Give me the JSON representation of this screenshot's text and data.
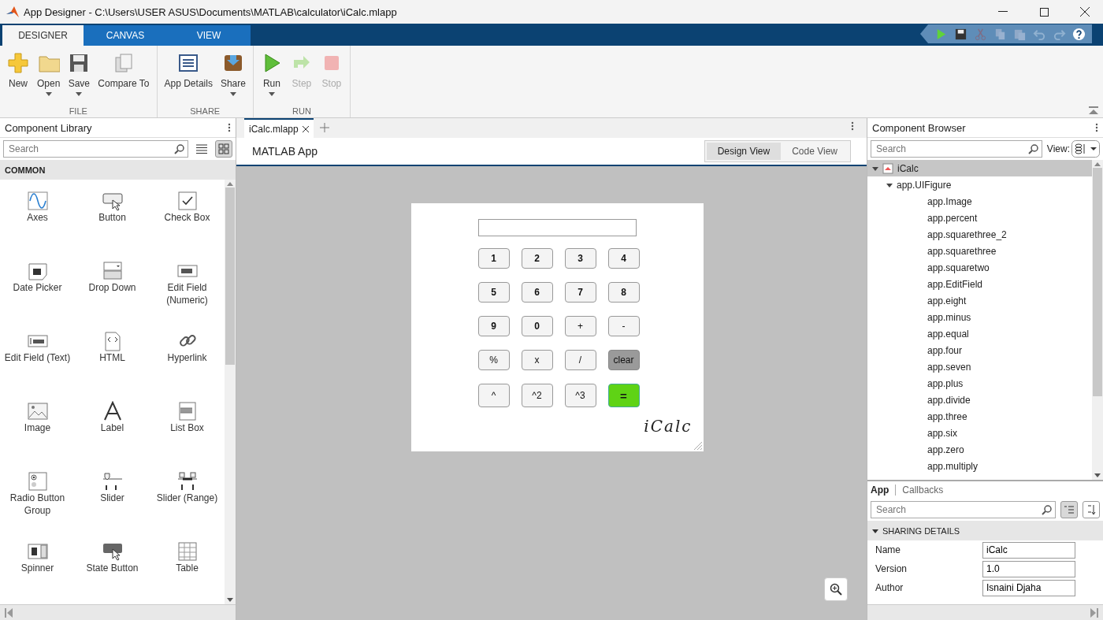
{
  "window": {
    "title": "App Designer - C:\\Users\\USER ASUS\\Documents\\MATLAB\\calculator\\iCalc.mlapp"
  },
  "ribbon_tabs": [
    {
      "label": "DESIGNER",
      "selected": true
    },
    {
      "label": "CANVAS",
      "selected": false
    },
    {
      "label": "VIEW",
      "selected": false
    }
  ],
  "toolbar_groups": [
    {
      "label": "FILE",
      "buttons": [
        {
          "label": "New",
          "dropdown": false,
          "disabled": false
        },
        {
          "label": "Open",
          "dropdown": true,
          "disabled": false
        },
        {
          "label": "Save",
          "dropdown": true,
          "disabled": false
        },
        {
          "label": "Compare To",
          "dropdown": false,
          "disabled": false
        }
      ]
    },
    {
      "label": "SHARE",
      "buttons": [
        {
          "label": "App Details",
          "dropdown": false,
          "disabled": false
        },
        {
          "label": "Share",
          "dropdown": true,
          "disabled": false
        }
      ]
    },
    {
      "label": "RUN",
      "buttons": [
        {
          "label": "Run",
          "dropdown": true,
          "disabled": false
        },
        {
          "label": "Step",
          "dropdown": false,
          "disabled": true
        },
        {
          "label": "Stop",
          "dropdown": false,
          "disabled": true
        }
      ]
    }
  ],
  "quick_access": [
    {
      "disabled": false
    },
    {
      "disabled": false
    },
    {
      "disabled": true
    },
    {
      "disabled": true
    },
    {
      "disabled": true
    },
    {
      "disabled": true
    },
    {
      "disabled": true
    },
    {
      "disabled": false
    }
  ],
  "component_library": {
    "title": "Component Library",
    "search": {
      "placeholder": "Search"
    },
    "views": [
      {
        "selected": false
      },
      {
        "selected": true
      }
    ],
    "section": "COMMON",
    "items": [
      "Axes",
      "Button",
      "Check Box",
      "Date Picker",
      "Drop Down",
      "Edit Field (Numeric)",
      "Edit Field (Text)",
      "HTML",
      "Hyperlink",
      "Image",
      "Label",
      "List Box",
      "Radio Button Group",
      "Slider",
      "Slider (Range)",
      "Spinner",
      "State Button",
      "Table"
    ]
  },
  "editor": {
    "tabs": [
      {
        "label": "iCalc.mlapp",
        "selected": true
      }
    ],
    "app_title": "MATLAB App",
    "views": [
      {
        "label": "Design View",
        "selected": true
      },
      {
        "label": "Code View",
        "selected": false
      }
    ],
    "calculator": {
      "logo": "iCalc",
      "buttons": [
        {
          "label": "1",
          "kind": "digit"
        },
        {
          "label": "2",
          "kind": "digit"
        },
        {
          "label": "3",
          "kind": "digit"
        },
        {
          "label": "4",
          "kind": "digit"
        },
        {
          "label": "5",
          "kind": "digit"
        },
        {
          "label": "6",
          "kind": "digit"
        },
        {
          "label": "7",
          "kind": "digit"
        },
        {
          "label": "8",
          "kind": "digit"
        },
        {
          "label": "9",
          "kind": "digit"
        },
        {
          "label": "0",
          "kind": "digit"
        },
        {
          "label": "+",
          "kind": "operator"
        },
        {
          "label": "-",
          "kind": "operator"
        },
        {
          "label": "%",
          "kind": "operator"
        },
        {
          "label": "x",
          "kind": "operator"
        },
        {
          "label": "/",
          "kind": "operator"
        },
        {
          "label": "clear",
          "kind": "clear"
        },
        {
          "label": "^",
          "kind": "operator"
        },
        {
          "label": "^2",
          "kind": "operator"
        },
        {
          "label": "^3",
          "kind": "operator"
        },
        {
          "label": "=",
          "kind": "equals"
        }
      ]
    }
  },
  "component_browser": {
    "title": "Component Browser",
    "search": {
      "placeholder": "Search"
    },
    "view_label": "View:",
    "tree": [
      {
        "label": "iCalc",
        "expanded": true,
        "selected": true,
        "children": [
          {
            "label": "app.UIFigure",
            "expanded": true,
            "selected": false,
            "children": [
              {
                "label": "app.Image",
                "selected": false
              },
              {
                "label": "app.percent",
                "selected": false
              },
              {
                "label": "app.squarethree_2",
                "selected": false
              },
              {
                "label": "app.squarethree",
                "selected": false
              },
              {
                "label": "app.squaretwo",
                "selected": false
              },
              {
                "label": "app.EditField",
                "selected": false
              },
              {
                "label": "app.eight",
                "selected": false
              },
              {
                "label": "app.minus",
                "selected": false
              },
              {
                "label": "app.equal",
                "selected": false
              },
              {
                "label": "app.four",
                "selected": false
              },
              {
                "label": "app.seven",
                "selected": false
              },
              {
                "label": "app.plus",
                "selected": false
              },
              {
                "label": "app.divide",
                "selected": false
              },
              {
                "label": "app.three",
                "selected": false
              },
              {
                "label": "app.six",
                "selected": false
              },
              {
                "label": "app.zero",
                "selected": false
              },
              {
                "label": "app.multiply",
                "selected": false
              }
            ]
          }
        ]
      }
    ]
  },
  "inspector": {
    "tabs": [
      {
        "label": "App",
        "selected": true
      },
      {
        "label": "Callbacks",
        "selected": false
      }
    ],
    "search": {
      "placeholder": "Search"
    },
    "section": {
      "label": "SHARING DETAILS",
      "expanded": true
    },
    "fields": [
      {
        "label": "Name",
        "value": "iCalc"
      },
      {
        "label": "Version",
        "value": "1.0"
      },
      {
        "label": "Author",
        "value": "Isnaini Djaha"
      }
    ]
  }
}
